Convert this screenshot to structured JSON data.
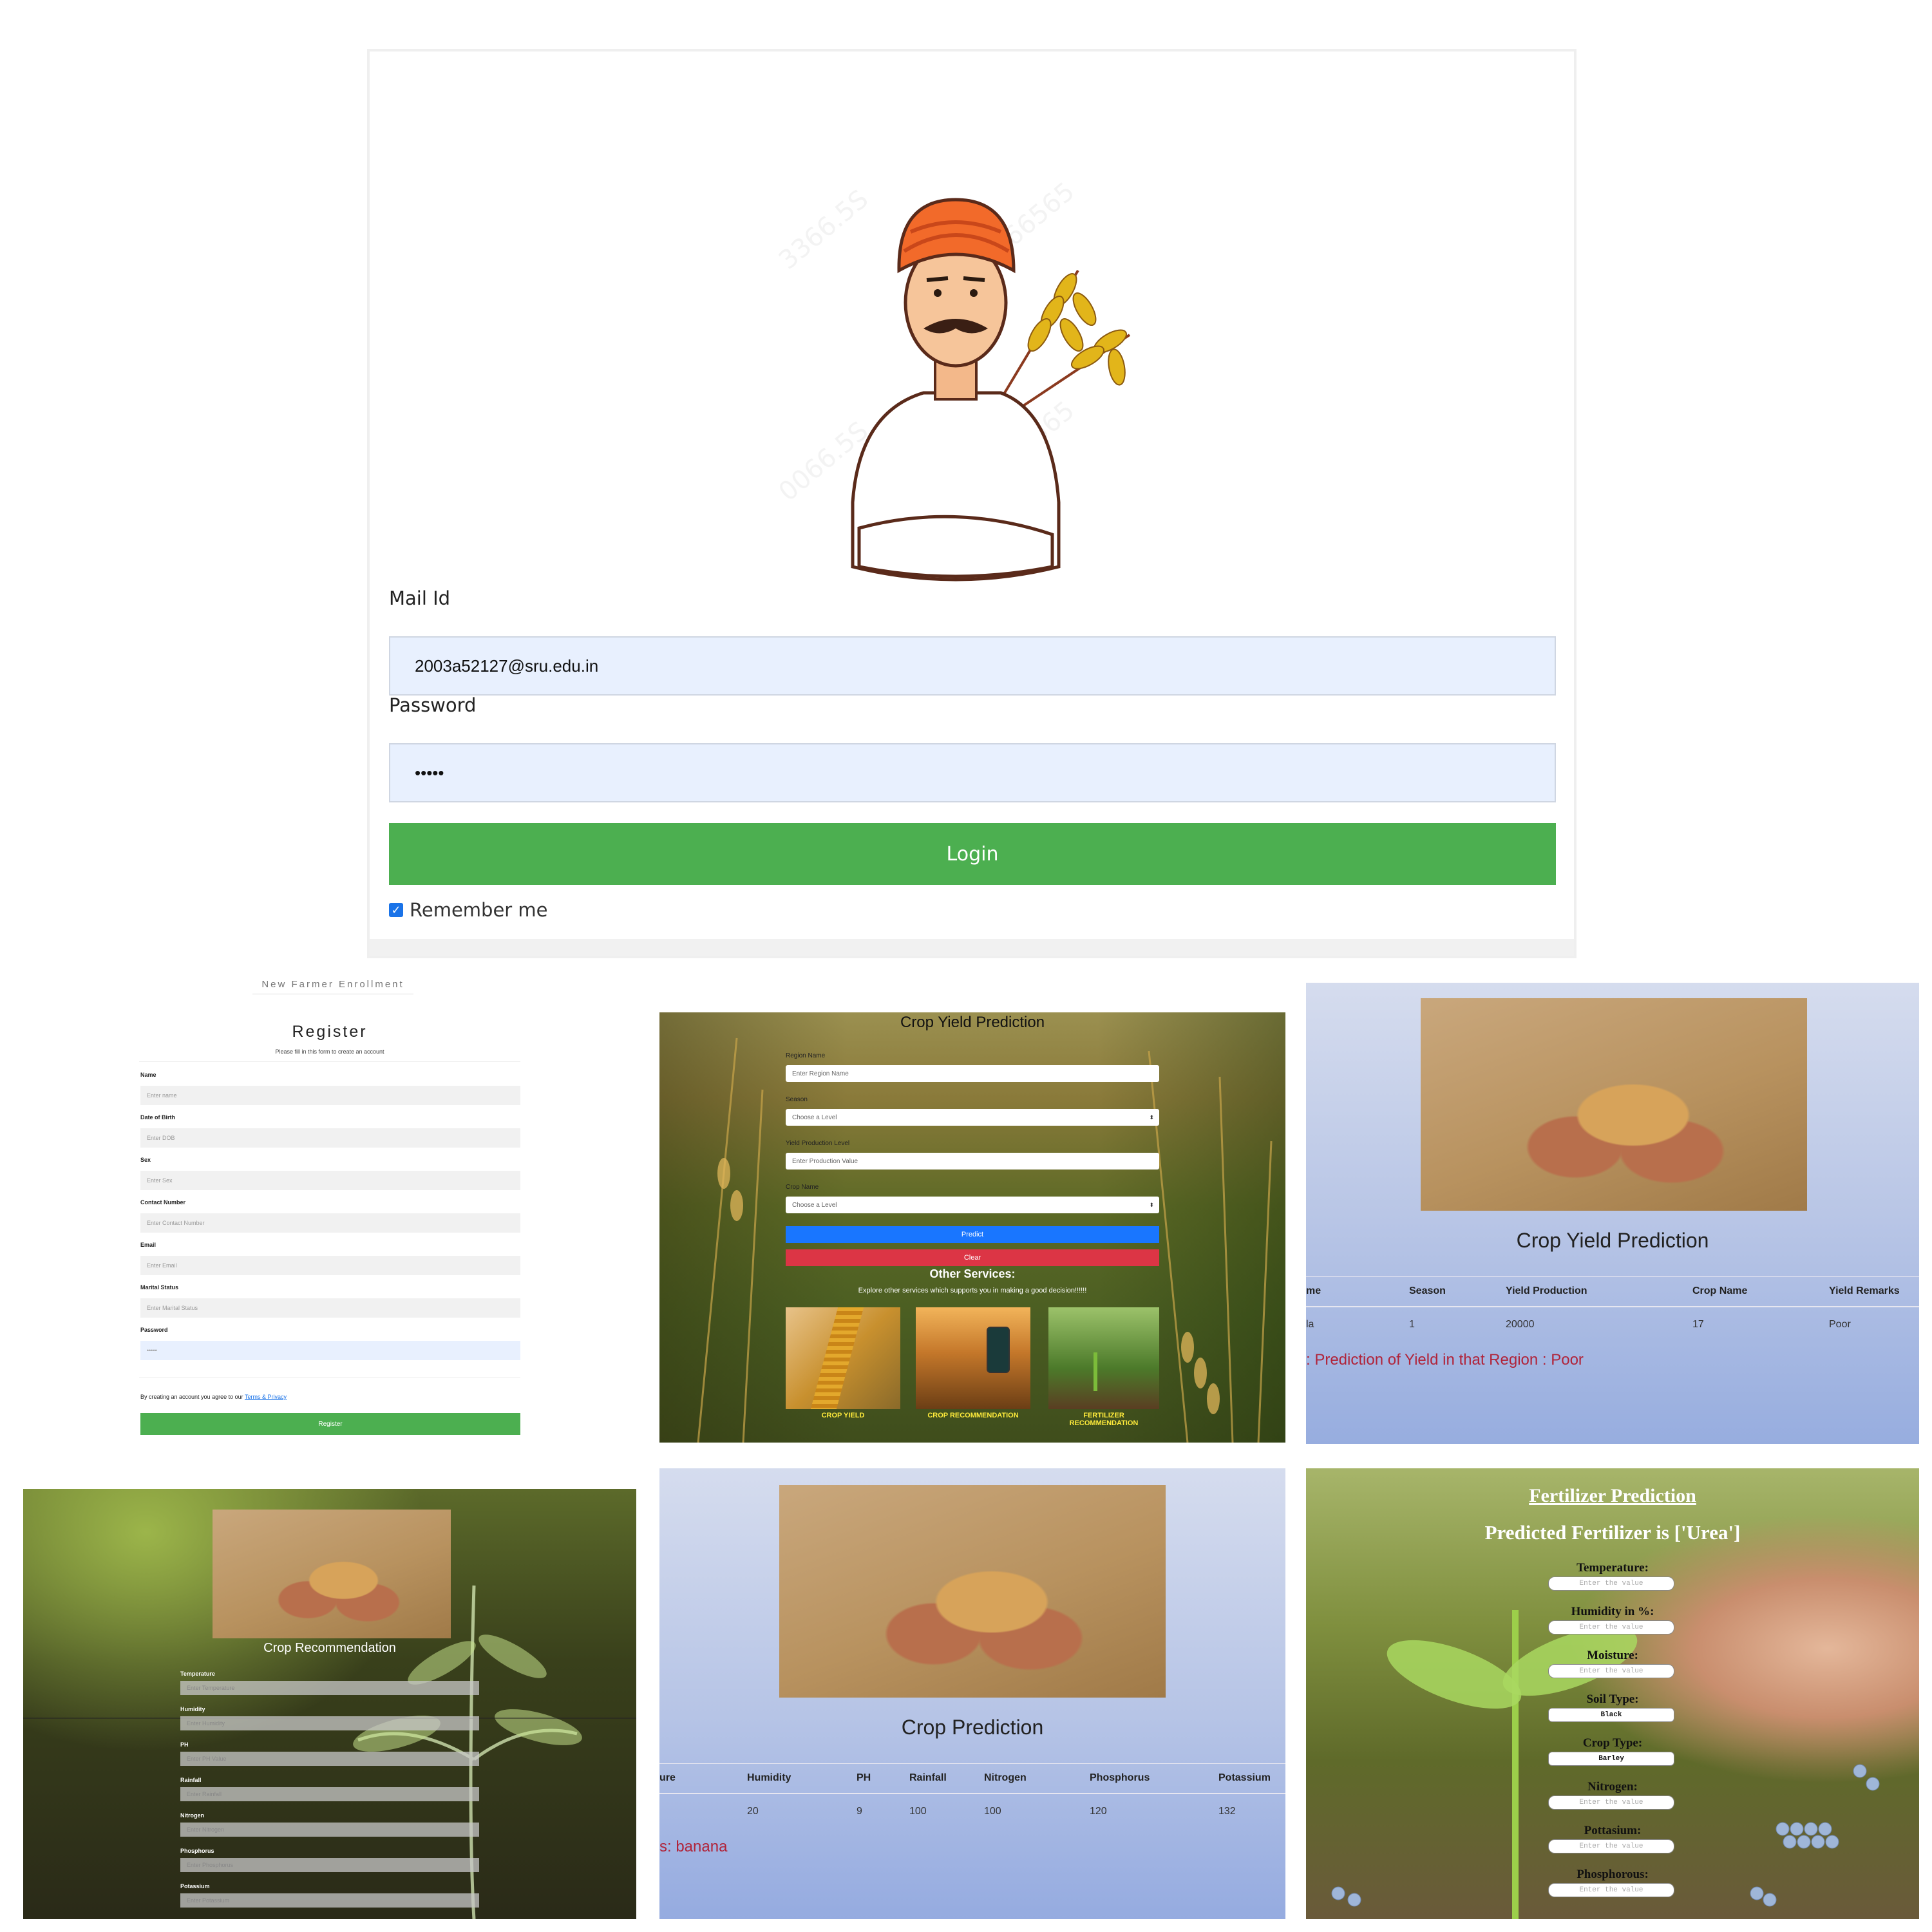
{
  "login": {
    "mail_label": "Mail Id",
    "mail_value": "2003a52127@sru.edu.in",
    "password_label": "Password",
    "password_value": "•••••",
    "login_button": "Login",
    "remember_label": "Remember me"
  },
  "register": {
    "enrollment_title": "New Farmer Enrollment",
    "title": "Register",
    "subtitle": "Please fill in this form to create an account",
    "fields": [
      {
        "label": "Name",
        "placeholder": "Enter name"
      },
      {
        "label": "Date of Birth",
        "placeholder": "Enter DOB"
      },
      {
        "label": "Sex",
        "placeholder": "Enter Sex"
      },
      {
        "label": "Contact Number",
        "placeholder": "Enter Contact Number"
      },
      {
        "label": "Email",
        "placeholder": "Enter Email"
      },
      {
        "label": "Marital Status",
        "placeholder": "Enter Marital Status"
      },
      {
        "label": "Password",
        "placeholder": "•••••"
      }
    ],
    "terms_text": "By creating an account you agree to our",
    "terms_link": "Terms & Privacy",
    "register_button": "Register"
  },
  "yield_form": {
    "title": "Crop Yield Prediction",
    "region_label": "Region Name",
    "region_placeholder": "Enter Region Name",
    "season_label": "Season",
    "season_value": "Choose a Level",
    "yield_label": "Yield Production Level",
    "yield_placeholder": "Enter Production Value",
    "crop_label": "Crop Name",
    "crop_value": "Choose a Level",
    "predict_button": "Predict",
    "clear_button": "Clear",
    "services_title": "Other Services:",
    "services_subtitle": "Explore other services which supports you in making a good decision!!!!!!",
    "services": [
      "CROP YIELD",
      "CROP RECOMMENDATION",
      "FERTILIZER RECOMMENDATION"
    ]
  },
  "yield_result": {
    "title": "Crop Yield Prediction",
    "headers": [
      "me",
      "Season",
      "Yield Production",
      "Crop Name",
      "Yield Remarks"
    ],
    "row": [
      "la",
      "1",
      "20000",
      "17",
      "Poor"
    ],
    "result_text": ": Prediction of Yield in that Region : Poor"
  },
  "recommendation": {
    "title": "Crop Recommendation",
    "fields": [
      {
        "label": "Temperature",
        "placeholder": "Enter Temperature"
      },
      {
        "label": "Humidity",
        "placeholder": "Enter Humidity"
      },
      {
        "label": "PH",
        "placeholder": "Enter PH Value"
      },
      {
        "label": "Rainfall",
        "placeholder": "Enter Rainfall"
      },
      {
        "label": "Nitrogen",
        "placeholder": "Enter Nitrogen"
      },
      {
        "label": "Phosphorus",
        "placeholder": "Enter Phosphorus"
      },
      {
        "label": "Potassium",
        "placeholder": "Enter Potassium"
      }
    ]
  },
  "crop_prediction": {
    "title": "Crop Prediction",
    "headers": [
      "ure",
      "Humidity",
      "PH",
      "Rainfall",
      "Nitrogen",
      "Phosphorus",
      "Potassium"
    ],
    "row": [
      "",
      "20",
      "9",
      "100",
      "100",
      "120",
      "132"
    ],
    "result_text": "s: banana"
  },
  "fertilizer": {
    "title": "Fertilizer Prediction",
    "result": "Predicted Fertilizer is ['Urea']",
    "fields": [
      {
        "label": "Temperature:",
        "value": "Enter the value"
      },
      {
        "label": "Humidity in %:",
        "value": "Enter the value"
      },
      {
        "label": "Moisture:",
        "value": "Enter the value"
      },
      {
        "label": "Soil Type:",
        "value": "Black"
      },
      {
        "label": "Crop Type:",
        "value": "Barley"
      },
      {
        "label": "Nitrogen:",
        "value": "Enter the value"
      },
      {
        "label": "Pottasium:",
        "value": "Enter the value"
      },
      {
        "label": "Phosphorous:",
        "value": "Enter the value"
      }
    ]
  },
  "colors": {
    "login_green": "#4caf50",
    "predict_blue": "#1976ff",
    "clear_red": "#dc3545",
    "result_red": "#b0243a"
  }
}
